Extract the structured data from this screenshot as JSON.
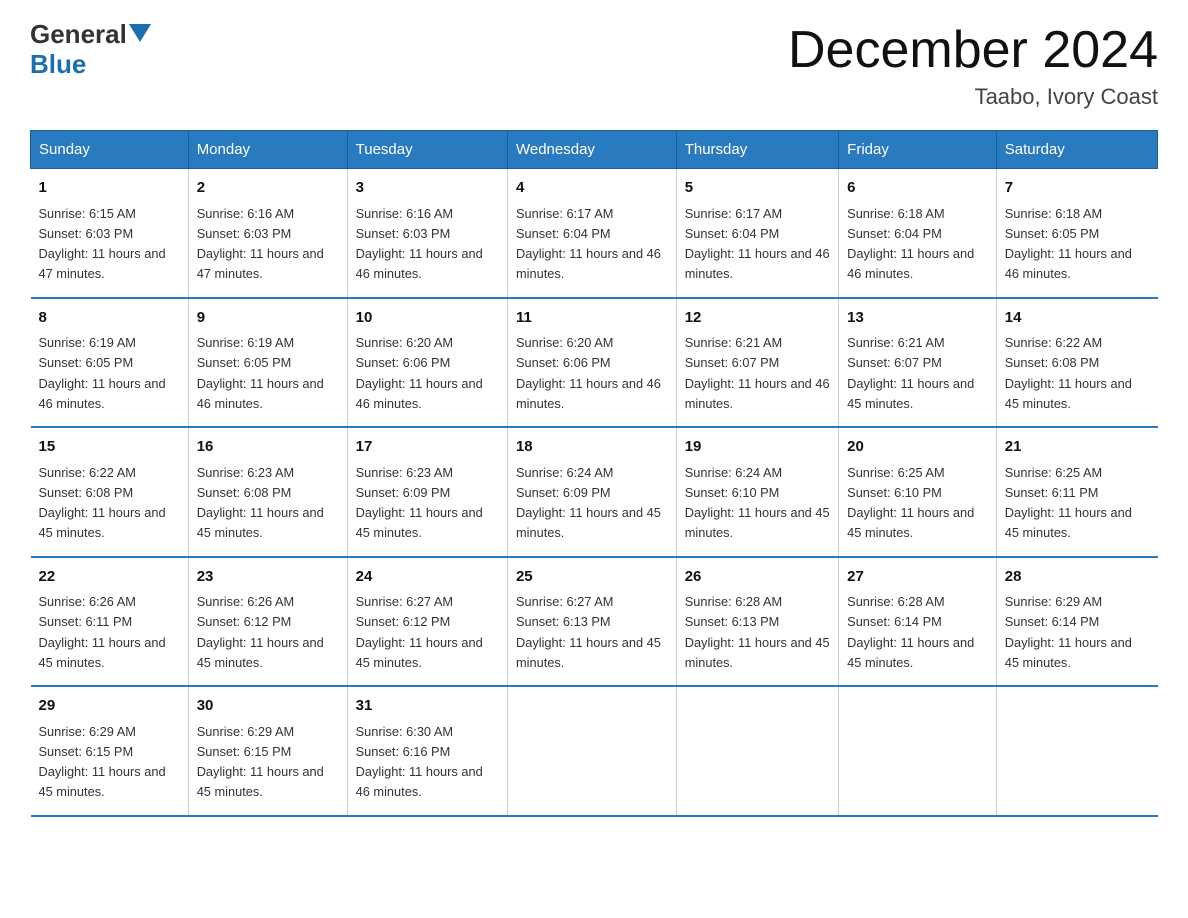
{
  "logo": {
    "line1": "General",
    "triangle": "▼",
    "line2": "Blue"
  },
  "title": "December 2024",
  "subtitle": "Taabo, Ivory Coast",
  "days_of_week": [
    "Sunday",
    "Monday",
    "Tuesday",
    "Wednesday",
    "Thursday",
    "Friday",
    "Saturday"
  ],
  "weeks": [
    [
      {
        "day": "1",
        "sunrise": "6:15 AM",
        "sunset": "6:03 PM",
        "daylight": "11 hours and 47 minutes."
      },
      {
        "day": "2",
        "sunrise": "6:16 AM",
        "sunset": "6:03 PM",
        "daylight": "11 hours and 47 minutes."
      },
      {
        "day": "3",
        "sunrise": "6:16 AM",
        "sunset": "6:03 PM",
        "daylight": "11 hours and 46 minutes."
      },
      {
        "day": "4",
        "sunrise": "6:17 AM",
        "sunset": "6:04 PM",
        "daylight": "11 hours and 46 minutes."
      },
      {
        "day": "5",
        "sunrise": "6:17 AM",
        "sunset": "6:04 PM",
        "daylight": "11 hours and 46 minutes."
      },
      {
        "day": "6",
        "sunrise": "6:18 AM",
        "sunset": "6:04 PM",
        "daylight": "11 hours and 46 minutes."
      },
      {
        "day": "7",
        "sunrise": "6:18 AM",
        "sunset": "6:05 PM",
        "daylight": "11 hours and 46 minutes."
      }
    ],
    [
      {
        "day": "8",
        "sunrise": "6:19 AM",
        "sunset": "6:05 PM",
        "daylight": "11 hours and 46 minutes."
      },
      {
        "day": "9",
        "sunrise": "6:19 AM",
        "sunset": "6:05 PM",
        "daylight": "11 hours and 46 minutes."
      },
      {
        "day": "10",
        "sunrise": "6:20 AM",
        "sunset": "6:06 PM",
        "daylight": "11 hours and 46 minutes."
      },
      {
        "day": "11",
        "sunrise": "6:20 AM",
        "sunset": "6:06 PM",
        "daylight": "11 hours and 46 minutes."
      },
      {
        "day": "12",
        "sunrise": "6:21 AM",
        "sunset": "6:07 PM",
        "daylight": "11 hours and 46 minutes."
      },
      {
        "day": "13",
        "sunrise": "6:21 AM",
        "sunset": "6:07 PM",
        "daylight": "11 hours and 45 minutes."
      },
      {
        "day": "14",
        "sunrise": "6:22 AM",
        "sunset": "6:08 PM",
        "daylight": "11 hours and 45 minutes."
      }
    ],
    [
      {
        "day": "15",
        "sunrise": "6:22 AM",
        "sunset": "6:08 PM",
        "daylight": "11 hours and 45 minutes."
      },
      {
        "day": "16",
        "sunrise": "6:23 AM",
        "sunset": "6:08 PM",
        "daylight": "11 hours and 45 minutes."
      },
      {
        "day": "17",
        "sunrise": "6:23 AM",
        "sunset": "6:09 PM",
        "daylight": "11 hours and 45 minutes."
      },
      {
        "day": "18",
        "sunrise": "6:24 AM",
        "sunset": "6:09 PM",
        "daylight": "11 hours and 45 minutes."
      },
      {
        "day": "19",
        "sunrise": "6:24 AM",
        "sunset": "6:10 PM",
        "daylight": "11 hours and 45 minutes."
      },
      {
        "day": "20",
        "sunrise": "6:25 AM",
        "sunset": "6:10 PM",
        "daylight": "11 hours and 45 minutes."
      },
      {
        "day": "21",
        "sunrise": "6:25 AM",
        "sunset": "6:11 PM",
        "daylight": "11 hours and 45 minutes."
      }
    ],
    [
      {
        "day": "22",
        "sunrise": "6:26 AM",
        "sunset": "6:11 PM",
        "daylight": "11 hours and 45 minutes."
      },
      {
        "day": "23",
        "sunrise": "6:26 AM",
        "sunset": "6:12 PM",
        "daylight": "11 hours and 45 minutes."
      },
      {
        "day": "24",
        "sunrise": "6:27 AM",
        "sunset": "6:12 PM",
        "daylight": "11 hours and 45 minutes."
      },
      {
        "day": "25",
        "sunrise": "6:27 AM",
        "sunset": "6:13 PM",
        "daylight": "11 hours and 45 minutes."
      },
      {
        "day": "26",
        "sunrise": "6:28 AM",
        "sunset": "6:13 PM",
        "daylight": "11 hours and 45 minutes."
      },
      {
        "day": "27",
        "sunrise": "6:28 AM",
        "sunset": "6:14 PM",
        "daylight": "11 hours and 45 minutes."
      },
      {
        "day": "28",
        "sunrise": "6:29 AM",
        "sunset": "6:14 PM",
        "daylight": "11 hours and 45 minutes."
      }
    ],
    [
      {
        "day": "29",
        "sunrise": "6:29 AM",
        "sunset": "6:15 PM",
        "daylight": "11 hours and 45 minutes."
      },
      {
        "day": "30",
        "sunrise": "6:29 AM",
        "sunset": "6:15 PM",
        "daylight": "11 hours and 45 minutes."
      },
      {
        "day": "31",
        "sunrise": "6:30 AM",
        "sunset": "6:16 PM",
        "daylight": "11 hours and 46 minutes."
      },
      null,
      null,
      null,
      null
    ]
  ]
}
